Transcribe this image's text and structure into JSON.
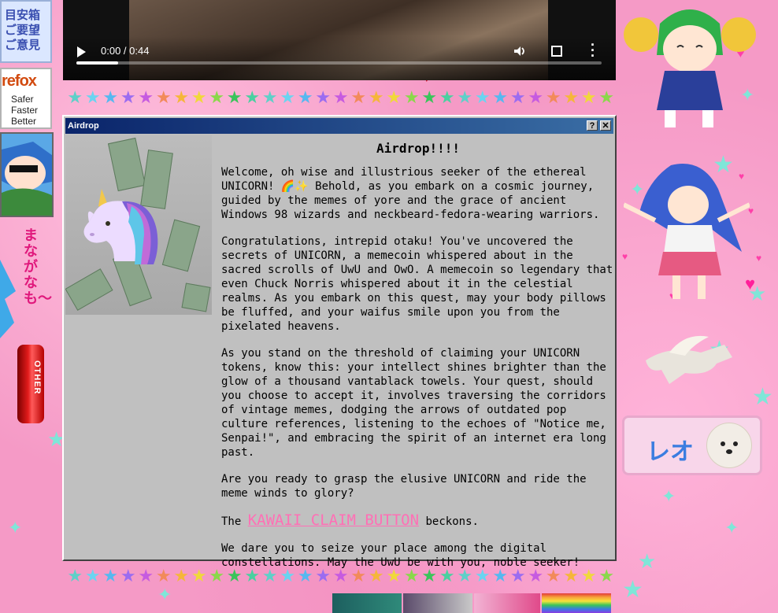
{
  "left": {
    "jp_lines": [
      "目安箱",
      "ご要望",
      "ご意見"
    ],
    "firefox": {
      "title": "refox",
      "lines": [
        "Safer",
        "Faster",
        "Better"
      ]
    },
    "vertical_text": "まながなも〜",
    "can_label": "OTHER"
  },
  "video": {
    "time": "0:00 / 0:44",
    "progress_fraction": 0.08
  },
  "window": {
    "title": "Airdrop",
    "help_button": "?",
    "close_button": "✕",
    "heading": "Airdrop!!!!",
    "paragraphs": [
      "Welcome, oh wise and illustrious seeker of the ethereal UNICORN! 🌈✨ Behold, as you embark on a cosmic journey, guided by the memes of yore and the grace of ancient Windows 98 wizards and neckbeard-fedora-wearing warriors.",
      "Congratulations, intrepid otaku! You've uncovered the secrets of UNICORN, a memecoin whispered about in the sacred scrolls of UwU and OwO. A memecoin so legendary that even Chuck Norris whispered about it in the celestial realms. As you embark on this quest, may your body pillows be fluffed, and your waifus smile upon you from the pixelated heavens.",
      "As you stand on the threshold of claiming your UNICORN tokens, know this: your intellect shines brighter than the glow of a thousand vantablack towels. Your quest, should you choose to accept it, involves traversing the corridors of vintage memes, dodging the arrows of outdated pop culture references, listening to the echoes of \"Notice me, Senpai!\", and embracing the spirit of an internet era long past.",
      "Are you ready to grasp the elusive UNICORN and ride the meme winds to glory?"
    ],
    "claim_prefix": "The ",
    "claim_link": "KAWAII CLAIM BUTTON",
    "claim_suffix": " beckons.",
    "closing": "We dare you to seize your place among the digital constellations. May the UwU be with you, noble seeker!"
  },
  "right": {
    "leo_text": "レオ"
  },
  "colors": {
    "background": "#f59ac6",
    "title_bar": "#0a246a",
    "window": "#c0c0c0",
    "kawaii": "#ff6fb5"
  }
}
